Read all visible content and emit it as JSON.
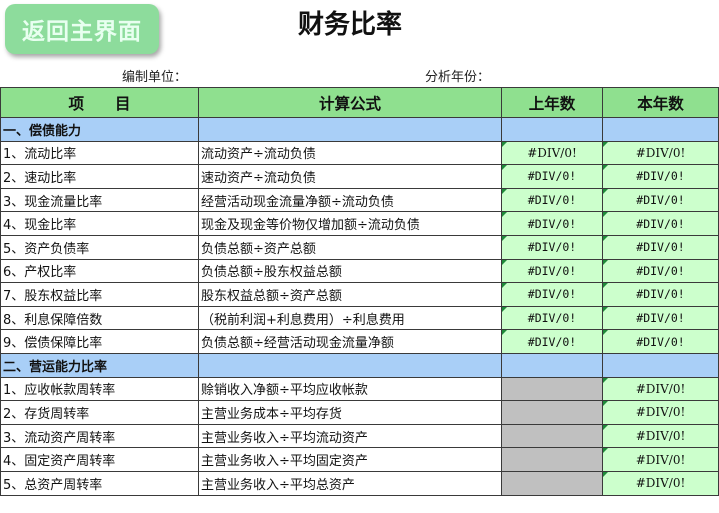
{
  "back_button": "返回主界面",
  "title": "财务比率",
  "meta": {
    "unit_label": "编制单位：",
    "year_label": "分析年份："
  },
  "table": {
    "headers": [
      "项　　目",
      "计算公式",
      "上年数",
      "本年数"
    ],
    "sections": [
      {
        "title": "一、偿债能力",
        "rows": [
          {
            "item": "1、流动比率",
            "formula": "流动资产÷流动负债",
            "prev": "#DIV/0!",
            "curr": "#DIV/0!",
            "style": "sans"
          },
          {
            "item": "2、速动比率",
            "formula": "速动资产÷流动负债",
            "prev": "#DIV/0!",
            "curr": "#DIV/0!",
            "style": "mono"
          },
          {
            "item": "3、现金流量比率",
            "formula": "经营活动现金流量净额÷流动负债",
            "prev": "#DIV/0!",
            "curr": "#DIV/0!",
            "style": "mono"
          },
          {
            "item": "4、现金比率",
            "formula": "现金及现金等价物仅增加额÷流动负债",
            "prev": "#DIV/0!",
            "curr": "#DIV/0!",
            "style": "mono"
          },
          {
            "item": "5、资产负债率",
            "formula": "负债总额÷资产总额",
            "prev": "#DIV/0!",
            "curr": "#DIV/0!",
            "style": "mono"
          },
          {
            "item": "6、产权比率",
            "formula": "负债总额÷股东权益总额",
            "prev": "#DIV/0!",
            "curr": "#DIV/0!",
            "style": "mono"
          },
          {
            "item": "7、股东权益比率",
            "formula": "股东权益总额÷资产总额",
            "prev": "#DIV/0!",
            "curr": "#DIV/0!",
            "style": "mono"
          },
          {
            "item": "8、利息保障倍数",
            "formula": "（税前利润+利息费用）÷利息费用",
            "prev": "#DIV/0!",
            "curr": "#DIV/0!",
            "style": "mono"
          },
          {
            "item": "9、偿债保障比率",
            "formula": "负债总额÷经营活动现金流量净额",
            "prev": "#DIV/0!",
            "curr": "#DIV/0!",
            "style": "mono"
          }
        ]
      },
      {
        "title": "二、营运能力比率",
        "rows": [
          {
            "item": "1、应收帐款周转率",
            "formula": "赊销收入净额÷平均应收帐款",
            "prev": "",
            "curr": "#DIV/0!",
            "style": "sans"
          },
          {
            "item": "2、存货周转率",
            "formula": "主营业务成本÷平均存货",
            "prev": "",
            "curr": "#DIV/0!",
            "style": "sans"
          },
          {
            "item": "3、流动资产周转率",
            "formula": "主营业务收入÷平均流动资产",
            "prev": "",
            "curr": "#DIV/0!",
            "style": "sans"
          },
          {
            "item": "4、固定资产周转率",
            "formula": "主营业务收入÷平均固定资产",
            "prev": "",
            "curr": "#DIV/0!",
            "style": "sans"
          },
          {
            "item": "5、总资产周转率",
            "formula": "主营业务收入÷平均总资产",
            "prev": "",
            "curr": "#DIV/0!",
            "style": "sans"
          }
        ]
      }
    ]
  }
}
